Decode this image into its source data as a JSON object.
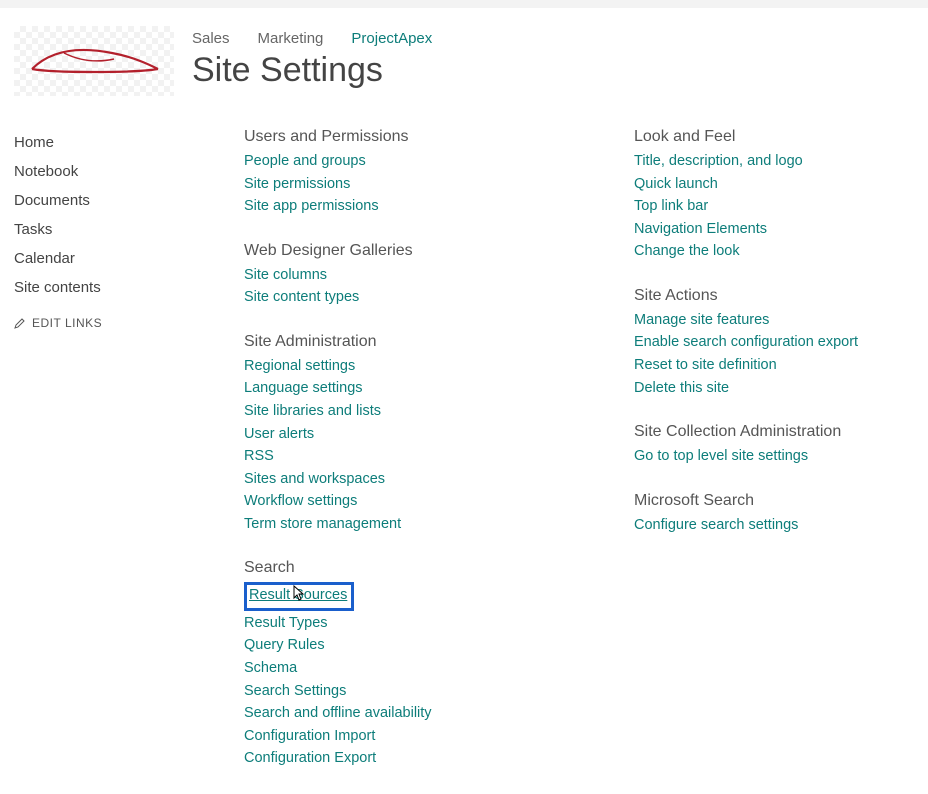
{
  "breadcrumb": [
    {
      "label": "Sales",
      "active": false
    },
    {
      "label": "Marketing",
      "active": false
    },
    {
      "label": "ProjectApex",
      "active": true
    }
  ],
  "page_title": "Site Settings",
  "left_nav": {
    "items": [
      "Home",
      "Notebook",
      "Documents",
      "Tasks",
      "Calendar",
      "Site contents"
    ],
    "edit_links_label": "EDIT LINKS"
  },
  "columns": [
    [
      {
        "heading": "Users and Permissions",
        "links": [
          "People and groups",
          "Site permissions",
          "Site app permissions"
        ]
      },
      {
        "heading": "Web Designer Galleries",
        "links": [
          "Site columns",
          "Site content types"
        ]
      },
      {
        "heading": "Site Administration",
        "links": [
          "Regional settings",
          "Language settings",
          "Site libraries and lists",
          "User alerts",
          "RSS",
          "Sites and workspaces",
          "Workflow settings",
          "Term store management"
        ]
      },
      {
        "heading": "Search",
        "links": [
          "Result Sources",
          "Result Types",
          "Query Rules",
          "Schema",
          "Search Settings",
          "Search and offline availability",
          "Configuration Import",
          "Configuration Export"
        ],
        "highlight_index": 0
      }
    ],
    [
      {
        "heading": "Look and Feel",
        "links": [
          "Title, description, and logo",
          "Quick launch",
          "Top link bar",
          "Navigation Elements",
          "Change the look"
        ]
      },
      {
        "heading": "Site Actions",
        "links": [
          "Manage site features",
          "Enable search configuration export",
          "Reset to site definition",
          "Delete this site"
        ]
      },
      {
        "heading": "Site Collection Administration",
        "links": [
          "Go to top level site settings"
        ]
      },
      {
        "heading": "Microsoft Search",
        "links": [
          "Configure search settings"
        ]
      }
    ]
  ]
}
